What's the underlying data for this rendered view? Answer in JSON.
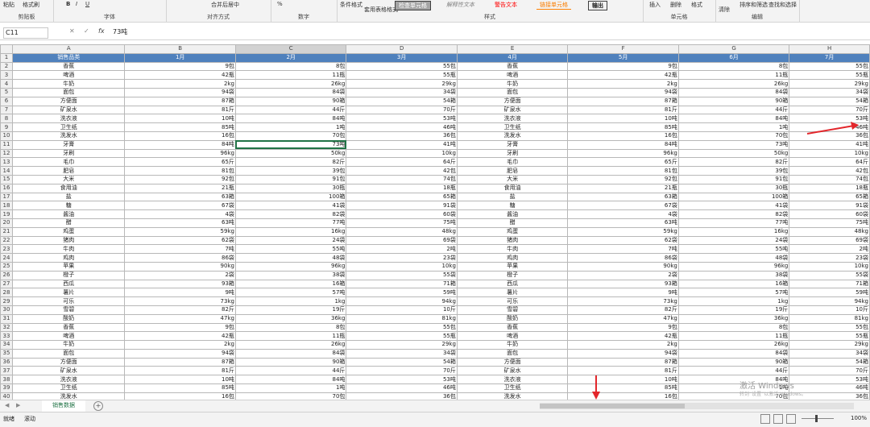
{
  "ribbon": {
    "clipboard": {
      "label": "剪贴板",
      "format_painter": "格式刷",
      "paste": "粘贴"
    },
    "font": {
      "label": "字体",
      "bold": "B",
      "italic": "I",
      "underline": "U"
    },
    "alignment": {
      "label": "对齐方式",
      "merge": "合并后居中"
    },
    "number": {
      "label": "数字",
      "percent": "%"
    },
    "styles": {
      "label": "样式",
      "cond_format": "条件格式",
      "table_format": "套用表格格式",
      "style1": "检查单元格",
      "style2": "解释性文本",
      "style3": "警告文本",
      "style4": "链接单元格",
      "style5": "输出"
    },
    "cells": {
      "label": "单元格",
      "insert": "插入",
      "delete": "删除",
      "format": "格式"
    },
    "editing": {
      "label": "编辑",
      "clear": "清除",
      "sort_filter": "排序和筛选",
      "find_select": "查找和选择"
    }
  },
  "formula_bar": {
    "name_box": "C11",
    "cancel": "✕",
    "confirm": "✓",
    "fx": "fx",
    "value": "73吨"
  },
  "columns": [
    "A",
    "B",
    "C",
    "D",
    "E",
    "F",
    "G",
    "H"
  ],
  "header_row": [
    "销售品类",
    "1月",
    "2月",
    "3月",
    "4月",
    "5月",
    "6月",
    "7月"
  ],
  "rows": [
    [
      "香蕉",
      "9包",
      "8包",
      "55包",
      "香蕉",
      "9包",
      "8包",
      "55包"
    ],
    [
      "啤酒",
      "42瓶",
      "11瓶",
      "55瓶",
      "啤酒",
      "42瓶",
      "11瓶",
      "55瓶"
    ],
    [
      "牛奶",
      "2kg",
      "26kg",
      "29kg",
      "牛奶",
      "2kg",
      "26kg",
      "29kg"
    ],
    [
      "面包",
      "94袋",
      "84袋",
      "34袋",
      "面包",
      "94袋",
      "84袋",
      "34袋"
    ],
    [
      "方便面",
      "87箱",
      "90箱",
      "54箱",
      "方便面",
      "87箱",
      "90箱",
      "54箱"
    ],
    [
      "矿泉水",
      "81斤",
      "44斤",
      "70斤",
      "矿泉水",
      "81斤",
      "44斤",
      "70斤"
    ],
    [
      "洗衣液",
      "10吨",
      "84吨",
      "53吨",
      "洗衣液",
      "10吨",
      "84吨",
      "53吨"
    ],
    [
      "卫生纸",
      "85吨",
      "1吨",
      "46吨",
      "卫生纸",
      "85吨",
      "1吨",
      "46吨"
    ],
    [
      "洗发水",
      "16包",
      "70包",
      "36包",
      "洗发水",
      "16包",
      "70包",
      "36包"
    ],
    [
      "牙膏",
      "84吨",
      "73吨",
      "41吨",
      "牙膏",
      "84吨",
      "73吨",
      "41吨"
    ],
    [
      "牙刷",
      "96kg",
      "50kg",
      "10kg",
      "牙刷",
      "96kg",
      "50kg",
      "10kg"
    ],
    [
      "毛巾",
      "65斤",
      "82斤",
      "64斤",
      "毛巾",
      "65斤",
      "82斤",
      "64斤"
    ],
    [
      "肥皂",
      "81包",
      "39包",
      "42包",
      "肥皂",
      "81包",
      "39包",
      "42包"
    ],
    [
      "大米",
      "92包",
      "91包",
      "74包",
      "大米",
      "92包",
      "91包",
      "74包"
    ],
    [
      "食用油",
      "21瓶",
      "30瓶",
      "18瓶",
      "食用油",
      "21瓶",
      "30瓶",
      "18瓶"
    ],
    [
      "盐",
      "63箱",
      "100箱",
      "65箱",
      "盐",
      "63箱",
      "100箱",
      "65箱"
    ],
    [
      "糖",
      "67袋",
      "41袋",
      "91袋",
      "糖",
      "67袋",
      "41袋",
      "91袋"
    ],
    [
      "酱油",
      "4袋",
      "82袋",
      "60袋",
      "酱油",
      "4袋",
      "82袋",
      "60袋"
    ],
    [
      "醋",
      "63吨",
      "77吨",
      "75吨",
      "醋",
      "63吨",
      "77吨",
      "75吨"
    ],
    [
      "鸡蛋",
      "59kg",
      "16kg",
      "48kg",
      "鸡蛋",
      "59kg",
      "16kg",
      "48kg"
    ],
    [
      "猪肉",
      "62袋",
      "24袋",
      "69袋",
      "猪肉",
      "62袋",
      "24袋",
      "69袋"
    ],
    [
      "牛肉",
      "7吨",
      "55吨",
      "2吨",
      "牛肉",
      "7吨",
      "55吨",
      "2吨"
    ],
    [
      "鸡肉",
      "86袋",
      "48袋",
      "23袋",
      "鸡肉",
      "86袋",
      "48袋",
      "23袋"
    ],
    [
      "苹果",
      "90kg",
      "96kg",
      "10kg",
      "苹果",
      "90kg",
      "96kg",
      "10kg"
    ],
    [
      "橙子",
      "2袋",
      "38袋",
      "55袋",
      "橙子",
      "2袋",
      "38袋",
      "55袋"
    ],
    [
      "西瓜",
      "93箱",
      "16箱",
      "71箱",
      "西瓜",
      "93箱",
      "16箱",
      "71箱"
    ],
    [
      "薯片",
      "9吨",
      "57吨",
      "59吨",
      "薯片",
      "9吨",
      "57吨",
      "59吨"
    ],
    [
      "可乐",
      "73kg",
      "1kg",
      "94kg",
      "可乐",
      "73kg",
      "1kg",
      "94kg"
    ],
    [
      "雪碧",
      "82斤",
      "19斤",
      "10斤",
      "雪碧",
      "82斤",
      "19斤",
      "10斤"
    ],
    [
      "酸奶",
      "47kg",
      "36kg",
      "81kg",
      "酸奶",
      "47kg",
      "36kg",
      "81kg"
    ],
    [
      "香蕉",
      "9包",
      "8包",
      "55包",
      "香蕉",
      "9包",
      "8包",
      "55包"
    ],
    [
      "啤酒",
      "42瓶",
      "11瓶",
      "55瓶",
      "啤酒",
      "42瓶",
      "11瓶",
      "55瓶"
    ],
    [
      "牛奶",
      "2kg",
      "26kg",
      "29kg",
      "牛奶",
      "2kg",
      "26kg",
      "29kg"
    ],
    [
      "面包",
      "94袋",
      "84袋",
      "34袋",
      "面包",
      "94袋",
      "84袋",
      "34袋"
    ],
    [
      "方便面",
      "87箱",
      "90箱",
      "54箱",
      "方便面",
      "87箱",
      "90箱",
      "54箱"
    ],
    [
      "矿泉水",
      "81斤",
      "44斤",
      "70斤",
      "矿泉水",
      "81斤",
      "44斤",
      "70斤"
    ],
    [
      "洗衣液",
      "10吨",
      "84吨",
      "53吨",
      "洗衣液",
      "10吨",
      "84吨",
      "53吨"
    ],
    [
      "卫生纸",
      "85吨",
      "1吨",
      "46吨",
      "卫生纸",
      "85吨",
      "1吨",
      "46吨"
    ],
    [
      "洗发水",
      "16包",
      "70包",
      "36包",
      "洗发水",
      "16包",
      "70包",
      "36包"
    ]
  ],
  "sheet_tab": "销售数据",
  "add_sheet": "+",
  "status": {
    "ready": "就绪",
    "scroll": "滚动",
    "zoom": "100%"
  },
  "watermark": {
    "line1": "激活 Windows",
    "line2": "转到“设置”以激活 Windows。"
  },
  "colors": {
    "header_fill": "#4f81bd",
    "header_text": "#ffffff",
    "selection": "#217346",
    "arrow": "#e3262b"
  }
}
